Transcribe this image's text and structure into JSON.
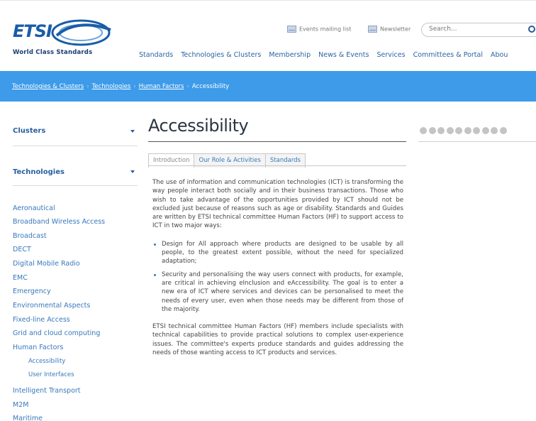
{
  "brand": {
    "logo_text": "ETSI",
    "tagline": "World Class Standards"
  },
  "utility": {
    "events_mailing_list": "Events mailing list",
    "newsletter": "Newsletter",
    "search_placeholder": "Search..."
  },
  "nav": {
    "items": [
      "Standards",
      "Technologies & Clusters",
      "Membership",
      "News & Events",
      "Services",
      "Committees & Portal",
      "Abou"
    ]
  },
  "breadcrumb": {
    "items": [
      "Technologies & Clusters",
      "Technologies",
      "Human Factors",
      "Accessibility"
    ]
  },
  "sidebar": {
    "clusters_heading": "Clusters",
    "technologies_heading": "Technologies",
    "items": [
      "Aeronautical",
      "Broadband Wireless Access",
      "Broadcast",
      "DECT",
      "Digital Mobile Radio",
      "EMC",
      "Emergency",
      "Environmental Aspects",
      "Fixed-line Access",
      "Grid and cloud computing",
      "Human Factors"
    ],
    "sub_items": [
      "Accessibility",
      "User Interfaces"
    ],
    "items_after": [
      "Intelligent Transport",
      "M2M",
      "Maritime"
    ]
  },
  "main": {
    "title": "Accessibility",
    "tabs": [
      "Introduction",
      "Our Role & Activities",
      "Standards"
    ],
    "paragraph1": "The use of information and communication technologies (ICT) is transforming the way people interact both socially and in their business transactions.  Those who wish to take advantage of the opportunities provided by ICT should not be excluded just because of reasons such as age or disability. Standards and Guides are written by ETSI technical committee Human Factors (HF) to support access to ICT in two major ways:",
    "bullets": [
      "Design for All approach where products are designed to be usable by all people, to the greatest extent possible, without the need for specialized adaptation;",
      "Security and personalising the way users connect with products, for example, are critical in achieving eInclusion and eAccessibility. The goal is to enter a new era of ICT where services and devices can be personalised to meet the needs of every user, even when those needs may be different from those of the majority."
    ],
    "paragraph2": "ETSI technical committee Human Factors (HF) members include specialists with technical capabilities to provide practical solutions to complex user-experience issues. The committee's experts produce standards and guides addressing the needs of those wanting  access  to ICT products and services."
  },
  "carousel": {
    "dot_count": 10
  },
  "colors": {
    "accent": "#3d9be9",
    "link": "#3878bb",
    "brand": "#1a5ca8"
  }
}
